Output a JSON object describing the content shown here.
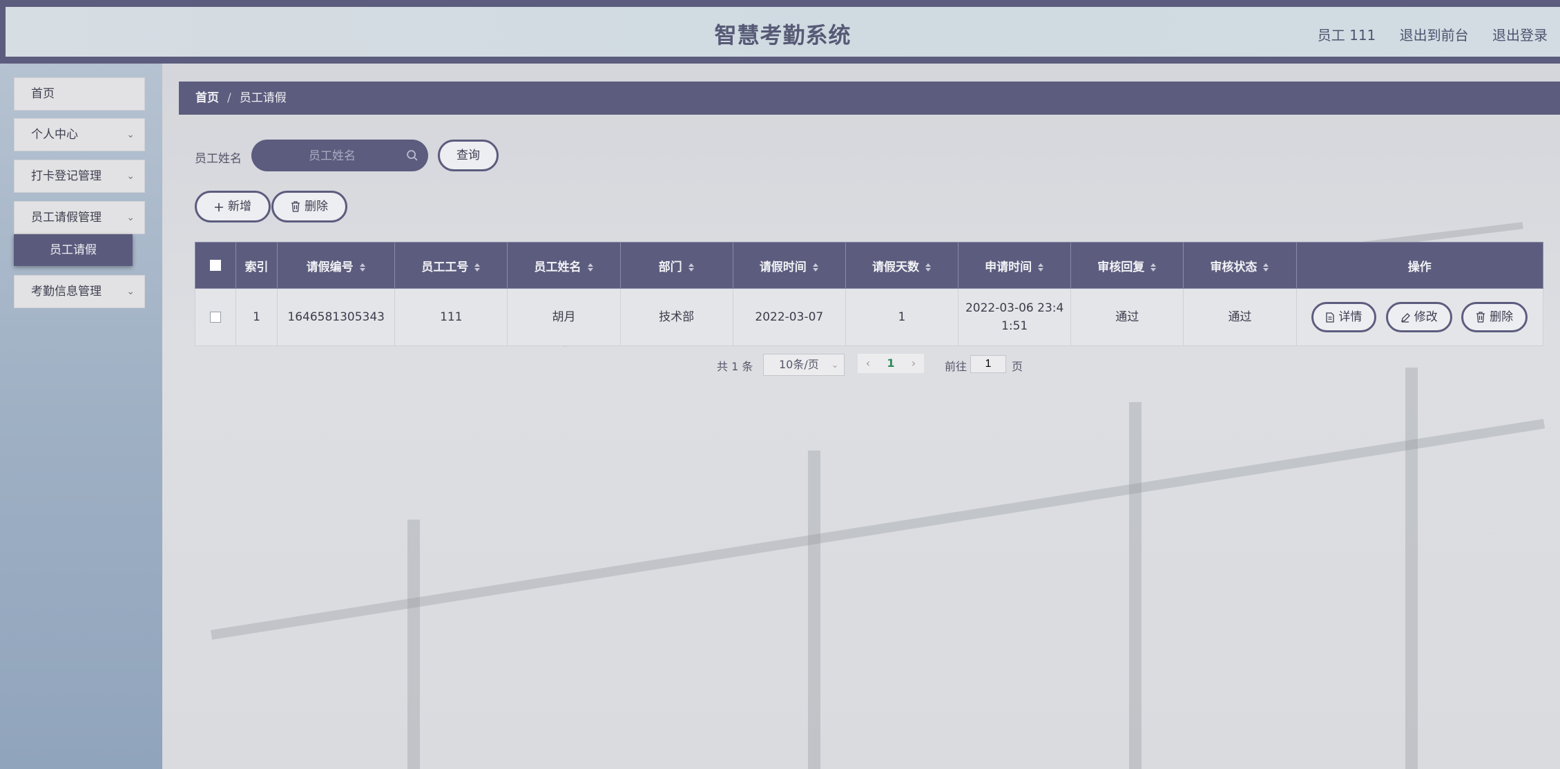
{
  "header": {
    "title": "智慧考勤系统",
    "user": "员工 111",
    "to_front": "退出到前台",
    "logout": "退出登录"
  },
  "sidebar": {
    "items": [
      {
        "label": "首页"
      },
      {
        "label": "个人中心"
      },
      {
        "label": "打卡登记管理"
      },
      {
        "label": "员工请假管理"
      },
      {
        "label": "考勤信息管理"
      }
    ],
    "active_sub": "员工请假"
  },
  "breadcrumb": {
    "home": "首页",
    "sep": "/",
    "current": "员工请假"
  },
  "search": {
    "label": "员工姓名",
    "placeholder": "员工姓名",
    "button": "查询"
  },
  "actions": {
    "add": "新增",
    "delete": "删除"
  },
  "table": {
    "headers": [
      "索引",
      "请假编号",
      "员工工号",
      "员工姓名",
      "部门",
      "请假时间",
      "请假天数",
      "申请时间",
      "审核回复",
      "审核状态",
      "操作"
    ],
    "rows": [
      {
        "index": "1",
        "leave_no": "1646581305343",
        "emp_no": "111",
        "emp_name": "胡月",
        "dept": "技术部",
        "leave_time": "2022-03-07",
        "days": "1",
        "apply_time": "2022-03-06 23:41:51",
        "reply": "通过",
        "status": "通过"
      }
    ],
    "row_actions": {
      "detail": "详情",
      "edit": "修改",
      "delete": "删除"
    }
  },
  "pagination": {
    "total": "共 1 条",
    "page_size": "10条/页",
    "current_page": "1",
    "goto_label": "前往",
    "goto_value": "1",
    "page_unit": "页"
  },
  "colors": {
    "primary": "#5c5c7e",
    "active_page": "#2e8b57"
  }
}
